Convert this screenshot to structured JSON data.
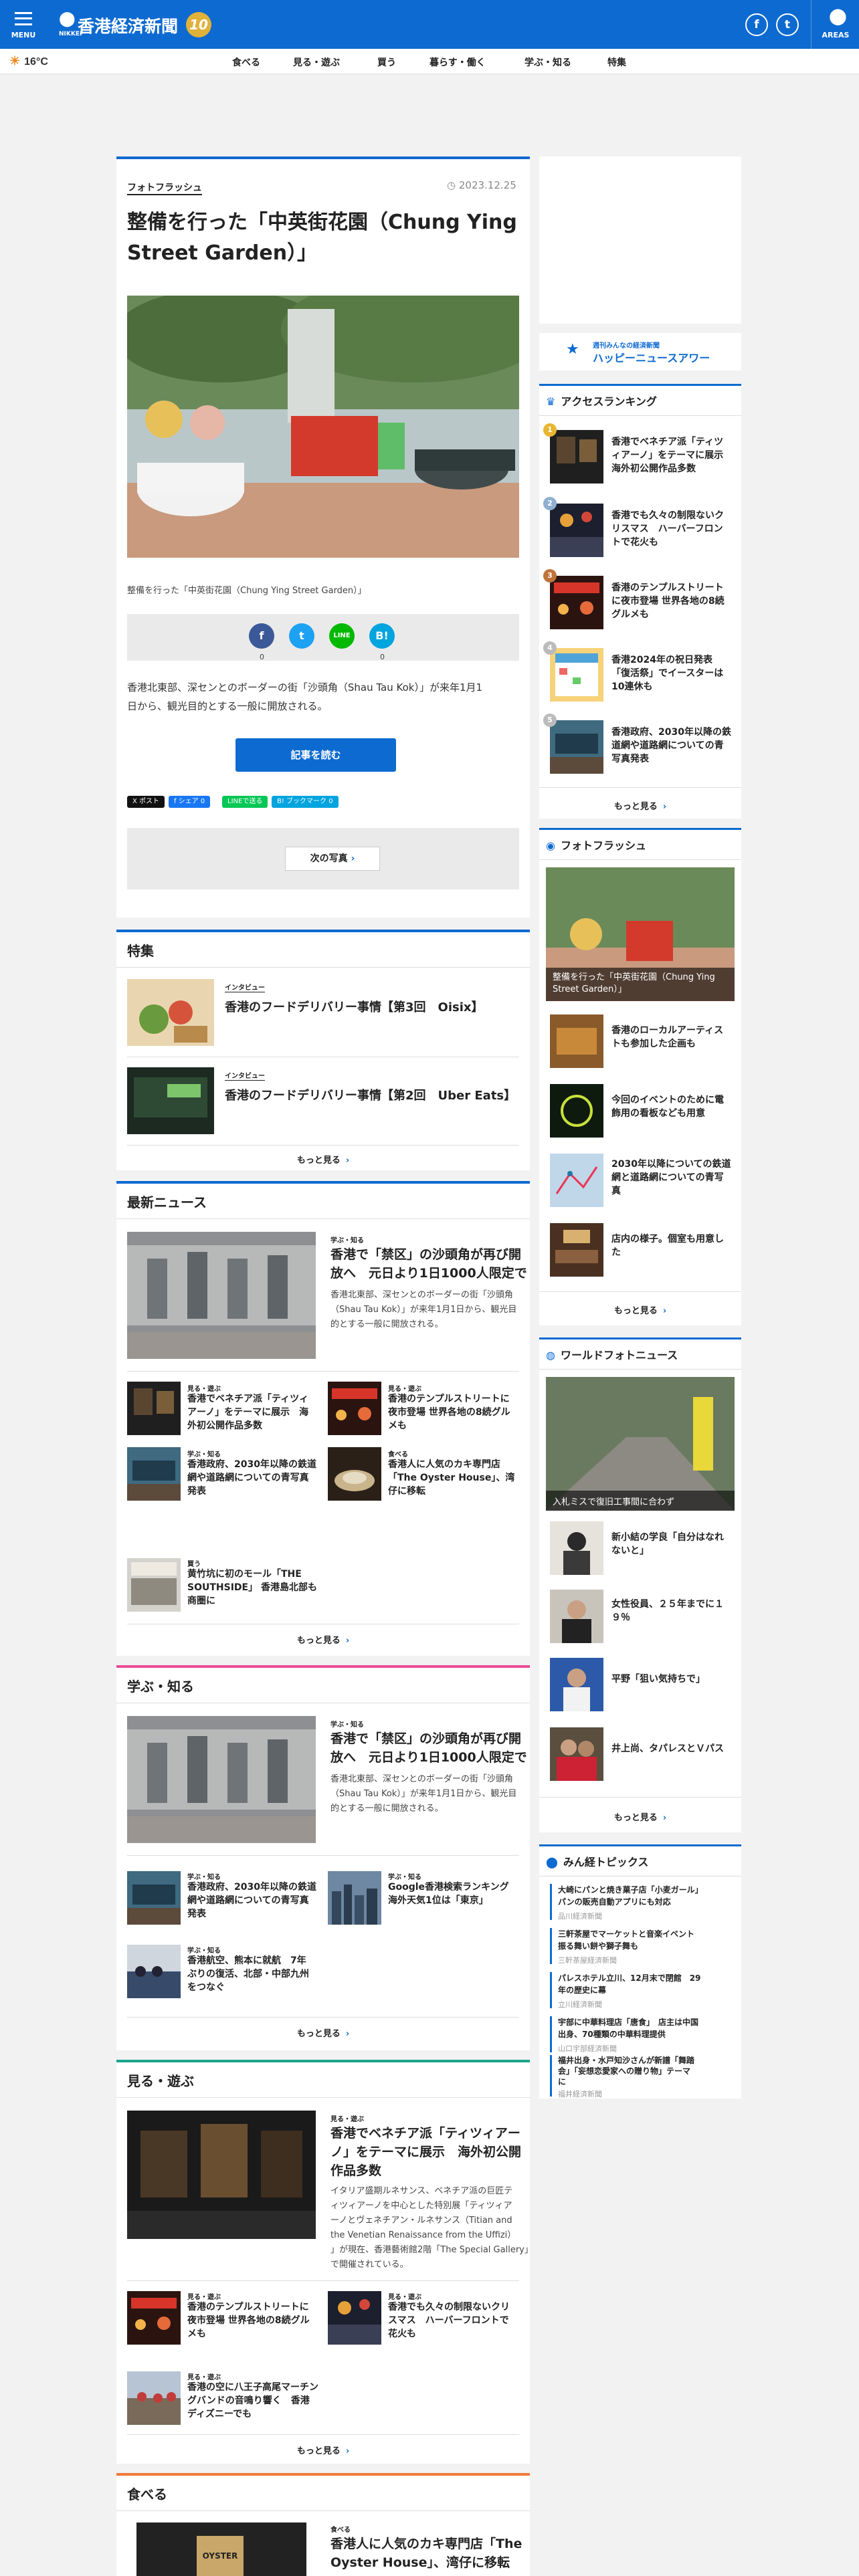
{
  "header": {
    "menu_label": "MENU",
    "logo_sub": "NIKKEI",
    "site_name": "香港経済新聞",
    "anniv": "10",
    "facebook_label": "f",
    "twitter_label": "t",
    "areas_label": "AREAS"
  },
  "nav": {
    "weather": "16°C",
    "items": [
      "食べる",
      "見る・遊ぶ",
      "買う",
      "暮らす・働く",
      "学ぶ・知る",
      "特集"
    ]
  },
  "article": {
    "category": "フォトフラッシュ",
    "date": "2023.12.25",
    "title_line1": "整備を行った「中英街花園（Chung Ying",
    "title_line2": "Street Garden）」",
    "caption": "整備を行った「中英街花園（Chung Ying Street Garden）」",
    "share_counts": [
      "0",
      "0"
    ],
    "body_line1": "香港北東部、深センとのボーダーの街「沙頭角（Shau Tau Kok）」が来年1月1",
    "body_line2": "日から、観光目的とする一般に開放される。",
    "read_button": "記事を読む",
    "mini_buttons": [
      "X ポスト",
      "f シェア 0",
      "LINEで送る",
      "B! ブックマーク 0"
    ],
    "next_button": "次の写真"
  },
  "tokushu": {
    "heading": "特集",
    "items": [
      {
        "tag": "インタビュー",
        "title": "香港のフードデリバリー事情【第3回　Oisix】"
      },
      {
        "tag": "インタビュー",
        "title": "香港のフードデリバリー事情【第2回　Uber Eats】"
      }
    ],
    "more": "もっと見る"
  },
  "latest": {
    "heading": "最新ニュース",
    "lead": {
      "tag": "学ぶ・知る",
      "title1": "香港で「禁区」の沙頭角が再び開",
      "title2": "放へ　元日より1日1000人限定で",
      "text1": "香港北東部、深センとのボーダーの街「沙頭角",
      "text2": "（Shau Tau Kok）」が来年1月1日から、観光目",
      "text3": "的とする一般に開放される。"
    },
    "items": [
      {
        "tag": "見る・遊ぶ",
        "t1": "香港でベネチア派「ティツィ",
        "t2": "アーノ」をテーマに展示　海",
        "t3": "外初公開作品多数"
      },
      {
        "tag": "見る・遊ぶ",
        "t1": "香港のテンプルストリートに",
        "t2": "夜市登場 世界各地の8続グル",
        "t3": "メも"
      },
      {
        "tag": "学ぶ・知る",
        "t1": "香港政府、2030年以降の鉄道",
        "t2": "網や道路網についての青写真",
        "t3": "発表"
      },
      {
        "tag": "食べる",
        "t1": "香港人に人気のカキ専門店",
        "t2": "「The Oyster House」、湾",
        "t3": "仔に移転"
      },
      {
        "tag": "買う",
        "t1": "黄竹坑に初のモール「THE",
        "t2": "SOUTHSIDE」 香港島北部も",
        "t3": "商圏に"
      }
    ],
    "more": "もっと見る"
  },
  "manabu": {
    "heading": "学ぶ・知る",
    "lead": {
      "tag": "学ぶ・知る",
      "title1": "香港で「禁区」の沙頭角が再び開",
      "title2": "放へ　元日より1日1000人限定で",
      "text1": "香港北東部、深センとのボーダーの街「沙頭角",
      "text2": "（Shau Tau Kok）」が来年1月1日から、観光目",
      "text3": "的とする一般に開放される。"
    },
    "items": [
      {
        "tag": "学ぶ・知る",
        "t1": "香港政府、2030年以降の鉄道",
        "t2": "網や道路網についての青写真",
        "t3": "発表"
      },
      {
        "tag": "学ぶ・知る",
        "t1": "Google香港検索ランキング",
        "t2": "海外天気1位は「東京」",
        "t3": ""
      },
      {
        "tag": "学ぶ・知る",
        "t1": "香港航空、熊本に就航　7年",
        "t2": "ぶりの復活、北部・中部九州",
        "t3": "をつなぐ"
      }
    ],
    "more": "もっと見る"
  },
  "miru": {
    "heading": "見る・遊ぶ",
    "lead": {
      "tag": "見る・遊ぶ",
      "title1": "香港でベネチア派「ティツィアー",
      "title2": "ノ」をテーマに展示　海外初公開",
      "title3": "作品多数",
      "text1": "イタリア盛期ルネサンス、ベネチア派の巨匠テ",
      "text2": "ィツィアーノを中心とした特別展「ティツィア",
      "text3": "ーノとヴェネチアン・ルネサンス（Titian and",
      "text4": "the Venetian Renaissance from the Uffizi）",
      "text5": "」が現在、香港藝術館2階「The Special Gallery」",
      "text6": "で開催されている。"
    },
    "items": [
      {
        "tag": "見る・遊ぶ",
        "t1": "香港のテンプルストリートに",
        "t2": "夜市登場 世界各地の8続グル",
        "t3": "メも"
      },
      {
        "tag": "見る・遊ぶ",
        "t1": "香港でも久々の制限ないクリ",
        "t2": "スマス　ハーバーフロントで",
        "t3": "花火も"
      },
      {
        "tag": "見る・遊ぶ",
        "t1": "香港の空に八王子高尾マーチン",
        "t2": "グバンドの音鳴り響く　香港",
        "t3": "ディズニーでも"
      }
    ],
    "more": "もっと見る"
  },
  "taberu": {
    "heading": "食べる",
    "lead": {
      "tag": "食べる",
      "title1": "香港人に人気のカキ専門店「The",
      "title2": "Oyster House」、湾仔に移転"
    },
    "thumb_text": "OYSTER"
  },
  "sidebar": {
    "happy_label": "週刊みんなの経済新聞",
    "happy_title": "ハッピーニュースアワー",
    "ranking": {
      "heading": "アクセスランキング",
      "items": [
        {
          "rank": "1",
          "t1": "香港でベネチア派「ティツ",
          "t2": "ィアーノ」をテーマに展示",
          "t3": "海外初公開作品多数"
        },
        {
          "rank": "2",
          "t1": "香港でも久々の制限ないク",
          "t2": "リスマス　ハーバーフロン",
          "t3": "トで花火も"
        },
        {
          "rank": "3",
          "t1": "香港のテンプルストリート",
          "t2": "に夜市登場 世界各地の8続",
          "t3": "グルメも"
        },
        {
          "rank": "4",
          "t1": "香港2024年の祝日発表",
          "t2": "「復活祭」でイースターは",
          "t3": "10連休も"
        },
        {
          "rank": "5",
          "t1": "香港政府、2030年以降の鉄",
          "t2": "道網や道路網についての青",
          "t3": "写真発表"
        }
      ],
      "more": "もっと見る"
    },
    "photoflash": {
      "heading": "フォトフラッシュ",
      "top_caption": "整備を行った「中英街花園（Chung Ying Street Garden）」",
      "items": [
        {
          "t1": "香港のローカルアーティス",
          "t2": "トも参加した企画も"
        },
        {
          "t1": "今回のイベントのために電",
          "t2": "飾用の看板なども用意"
        },
        {
          "t1": "2030年以降についての鉄道",
          "t2": "網と道路網についての青写",
          "t3": "真"
        },
        {
          "t1": "店内の様子。個室も用意し",
          "t2": "た"
        }
      ],
      "more": "もっと見る"
    },
    "world": {
      "heading": "ワールドフォトニュース",
      "top_caption": "入札ミスで復旧工事間に合わず",
      "items": [
        {
          "t1": "新小結の学良「自分はなれ",
          "t2": "ないと」"
        },
        {
          "t1": "女性役員、２５年までに１",
          "t2": "９％"
        },
        {
          "t1": "平野「狙い気持ちで」",
          "t2": ""
        },
        {
          "t1": "井上尚、タパレスとＶパス",
          "t2": ""
        }
      ],
      "more": "もっと見る"
    },
    "minna": {
      "heading": "みん経トピックス",
      "items": [
        {
          "t1": "大崎にパンと焼き菓子店「小麦ガール」",
          "t2": "パンの販売自動アプリにも対応",
          "src": "品川経済新聞"
        },
        {
          "t1": "三軒茶屋でマーケットと音楽イベント",
          "t2": "振る舞い餅や獅子舞も",
          "src": "三軒茶屋経済新聞"
        },
        {
          "t1": "パレスホテル立川、12月末で閉館　29",
          "t2": "年の歴史に幕",
          "src": "立川経済新聞"
        },
        {
          "t1": "宇部に中華料理店「唐食」　店主は中国",
          "t2": "出身、70種類の中華料理提供",
          "src": "山口宇部経済新聞"
        },
        {
          "t1": "福井出身・水戸知沙さんが新譜「舞踏",
          "t2": "会」「妄想恋愛家への贈り物」テーマ",
          "t3": "に",
          "src": "福井経済新聞"
        }
      ]
    }
  }
}
